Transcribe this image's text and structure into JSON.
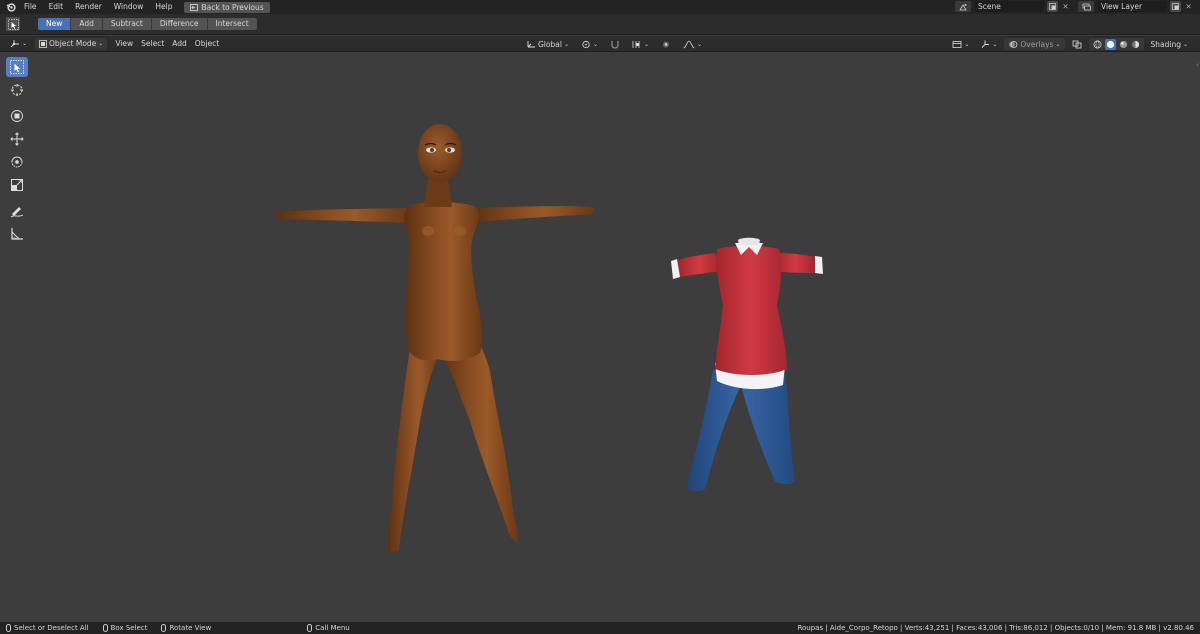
{
  "topbar": {
    "menus": [
      "File",
      "Edit",
      "Render",
      "Window",
      "Help"
    ],
    "back_button": "Back to Previous",
    "scene_field": "Scene",
    "view_layer_field": "View Layer"
  },
  "tool_settings": {
    "boolean_modes": [
      "New",
      "Add",
      "Subtract",
      "Difference",
      "Intersect"
    ],
    "active_mode": "New"
  },
  "header": {
    "mode": "Object Mode",
    "menus": [
      "View",
      "Select",
      "Add",
      "Object"
    ],
    "orientation": "Global",
    "overlays": "Overlays",
    "shading": "Shading"
  },
  "toolbar": {
    "tools": [
      "select-box",
      "cursor",
      "transform-move-square",
      "move",
      "rotate",
      "scale",
      "annotate",
      "measure"
    ],
    "active": "select-box"
  },
  "statusbar": {
    "left": [
      {
        "icon": "mouse-left-icon",
        "label": "Select or Deselect All"
      },
      {
        "icon": "mouse-left-icon",
        "label": "Box Select"
      },
      {
        "icon": "mouse-middle-icon",
        "label": "Rotate View"
      },
      {
        "icon": "mouse-right-icon",
        "label": "Call Menu"
      }
    ],
    "stats": "Roupas | Aide_Corpo_Retopo | Verts:43,251 | Faces:43,006 | Tris:86,012 | Objects:0/10 | Mem: 91.8 MB | v2.80.46"
  },
  "colors": {
    "accent": "#4772b3",
    "viewport": "#3d3d3d",
    "skin": "#8a4d1f",
    "shirt": "#c9353f",
    "jeans": "#2f5b98"
  }
}
